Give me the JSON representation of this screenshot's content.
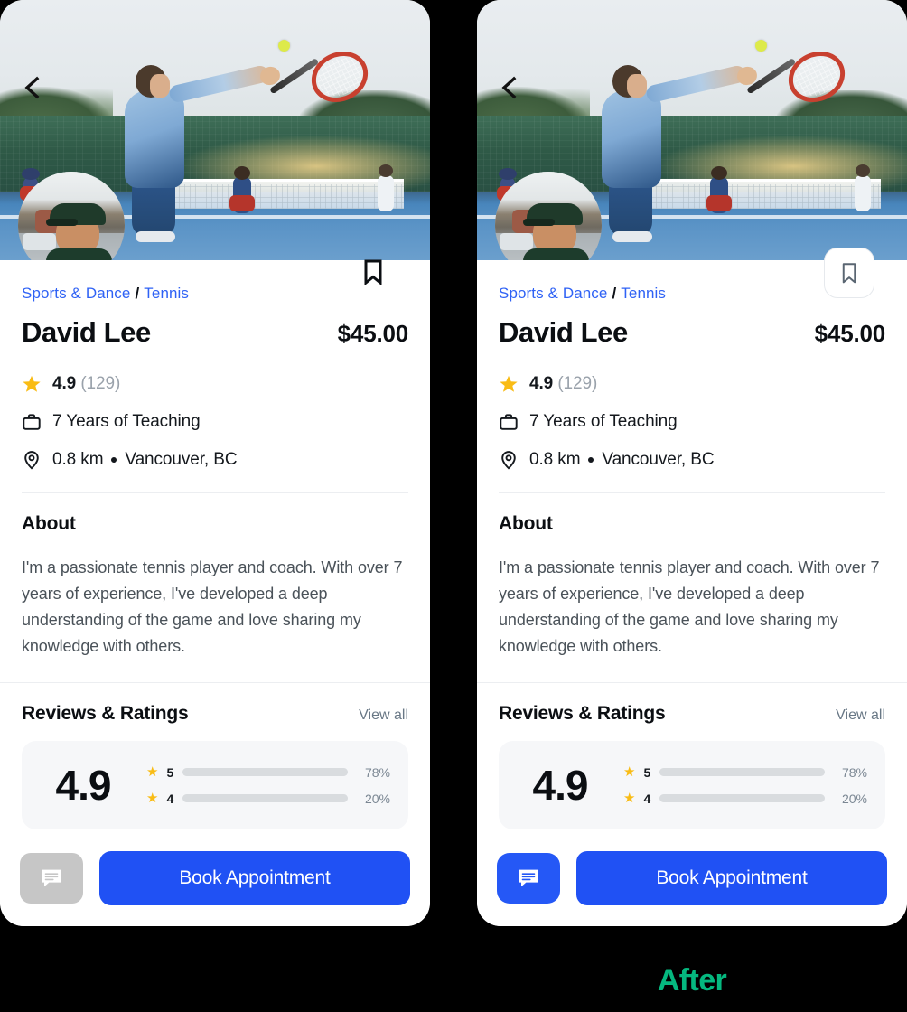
{
  "comparison": {
    "after_label": "After"
  },
  "colors": {
    "brand_blue": "#2051f4",
    "link_blue": "#2f62f5",
    "star_yellow": "#fbbf1c",
    "after_green": "#05b87f",
    "chat_disabled_gray": "#c6c6c6",
    "muted_text": "#697886",
    "card_bg": "#f6f7f9"
  },
  "profile": {
    "back_icon": "chevron-left-icon",
    "bookmark_icon": "bookmark-icon",
    "avatar_alt": "coach-avatar",
    "hero_alt": "tennis-player-serving-photo",
    "breadcrumb": {
      "category": "Sports & Dance",
      "separator": "/",
      "subcategory": "Tennis"
    },
    "name": "David Lee",
    "price": "$45.00",
    "rating": {
      "icon": "star-icon",
      "value": "4.9",
      "count": "(129)"
    },
    "experience": {
      "icon": "briefcase-icon",
      "text": "7 Years of Teaching"
    },
    "location": {
      "icon": "map-pin-icon",
      "distance": "0.8 km",
      "separator": "•",
      "city": "Vancouver, BC"
    }
  },
  "about": {
    "title": "About",
    "body": "I'm a passionate tennis player and coach. With over 7  years of experience, I've developed a deep understanding of the game and love sharing my knowledge with others."
  },
  "reviews": {
    "title": "Reviews & Ratings",
    "view_all": "View all",
    "score": "4.9",
    "breakdown": [
      {
        "stars": "5",
        "pct_label": "78%",
        "pct": 78
      },
      {
        "stars": "4",
        "pct_label": "20%",
        "pct": 20
      }
    ]
  },
  "bottom_bar": {
    "chat_icon": "chat-message-icon",
    "book_label": "Book Appointment"
  }
}
